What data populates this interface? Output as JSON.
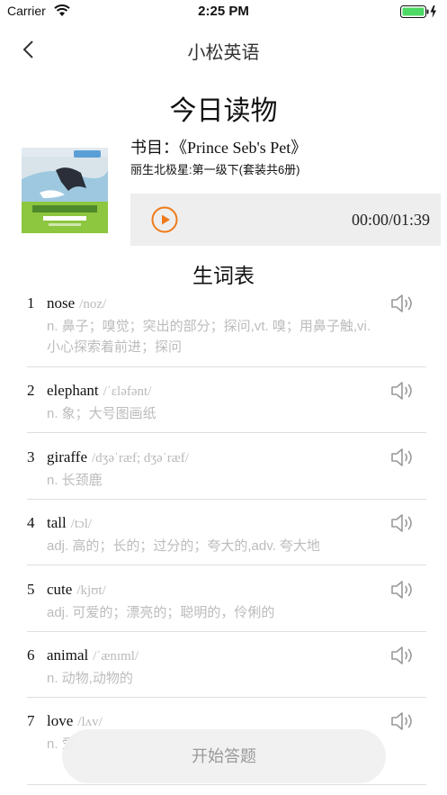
{
  "status_bar": {
    "carrier": "Carrier",
    "time": "2:25 PM"
  },
  "nav": {
    "title": "小松英语"
  },
  "page_title": "今日读物",
  "book": {
    "label": "书目：《Prince Seb's Pet》",
    "series": "丽生北极星:第一级下(套装共6册)"
  },
  "player": {
    "time": "00:00/01:39",
    "accent": "#f07a1a"
  },
  "vocab_title": "生词表",
  "words": [
    {
      "num": "1",
      "word": "nose",
      "ipa": "/noz/",
      "def": "n. 鼻子；嗅觉；突出的部分；探问,vt. 嗅；用鼻子触,vi. 小心探索着前进；探问"
    },
    {
      "num": "2",
      "word": "elephant",
      "ipa": "/ˈɛləfənt/",
      "def": "n. 象；大号图画纸"
    },
    {
      "num": "3",
      "word": "giraffe",
      "ipa": "/dʒəˈræf; dʒəˈræf/",
      "def": "n. 长颈鹿"
    },
    {
      "num": "4",
      "word": "tall",
      "ipa": "/tɔl/",
      "def": "adj. 高的；长的；过分的；夸大的,adv. 夸大地"
    },
    {
      "num": "5",
      "word": "cute",
      "ipa": "/kjʊt/",
      "def": "adj. 可爱的；漂亮的；聪明的，伶俐的"
    },
    {
      "num": "6",
      "word": "animal",
      "ipa": "/ˈænɪml/",
      "def": "n. 动物,动物的"
    },
    {
      "num": "7",
      "word": "love",
      "ipa": "/lʌv/",
      "def": "n. 爱"
    }
  ],
  "start_button": "开始答题"
}
